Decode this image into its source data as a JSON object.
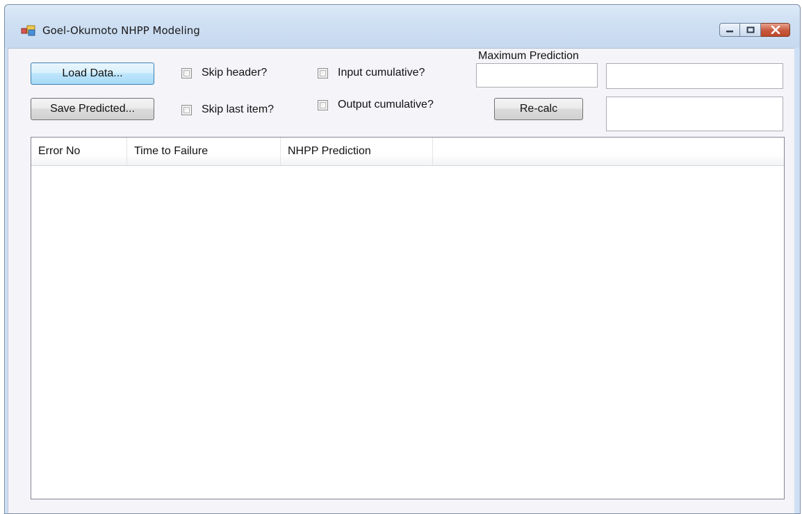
{
  "window": {
    "title": "Goel-Okumoto NHPP Modeling"
  },
  "toolbar": {
    "load_label": "Load Data...",
    "save_label": "Save Predicted...",
    "skip_header_label": "Skip header?",
    "skip_last_label": "Skip last item?",
    "input_cumulative_label": "Input cumulative?",
    "output_cumulative_label": "Output cumulative?",
    "max_prediction_label": "Maximum Prediction",
    "recalc_label": "Re-calc",
    "max_prediction_value": "",
    "result_top_value": "",
    "result_bottom_value": ""
  },
  "listview": {
    "columns": [
      "Error No",
      "Time to Failure",
      "NHPP Prediction"
    ],
    "rows": []
  },
  "colors": {
    "client_bg": "#f5f4f9",
    "frame": "#cfe0f4",
    "close": "#c75a3e"
  },
  "icons": [
    "app-icon",
    "minimize-icon",
    "maximize-icon",
    "close-icon"
  ]
}
